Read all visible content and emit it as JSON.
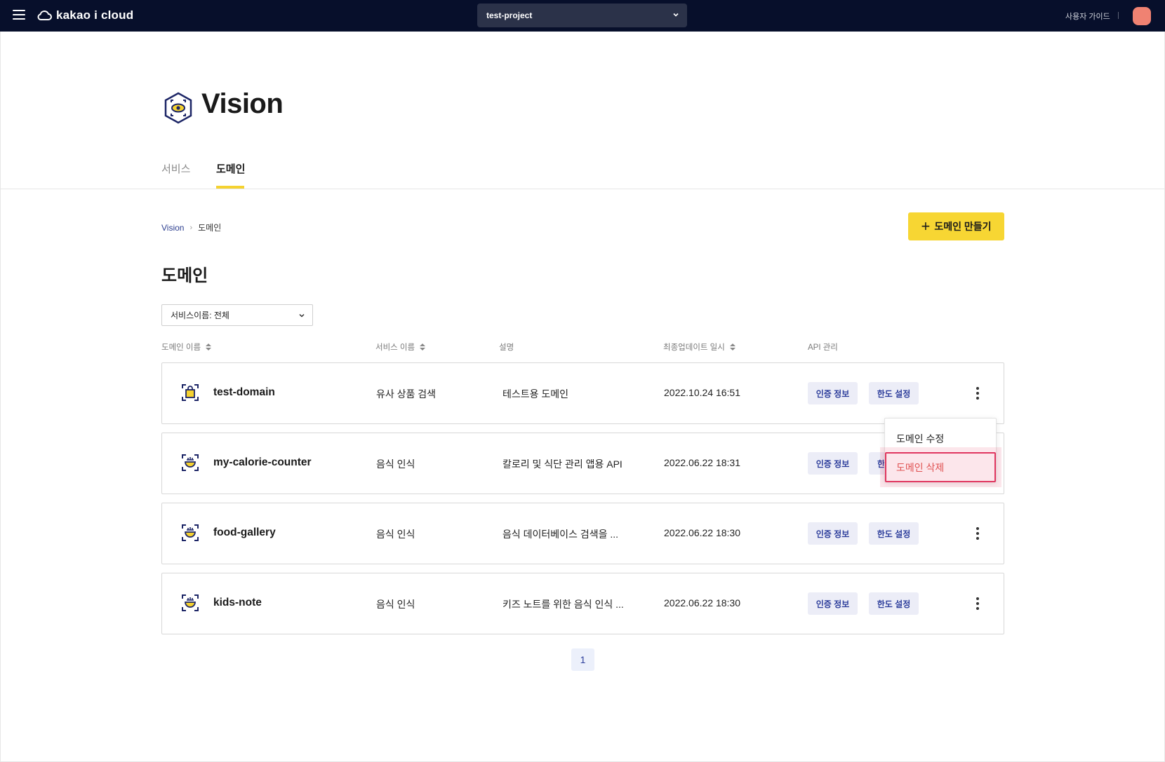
{
  "topbar": {
    "logo_text": "kakao i cloud",
    "project": "test-project",
    "user_guide": "사용자 가이드"
  },
  "hero": {
    "title": "Vision"
  },
  "tabs": [
    {
      "label": "서비스",
      "active": false
    },
    {
      "label": "도메인",
      "active": true
    }
  ],
  "breadcrumb": {
    "root": "Vision",
    "current": "도메인"
  },
  "create_button": "도메인 만들기",
  "section_title": "도메인",
  "filter": {
    "label": "서비스이름: 전체"
  },
  "table": {
    "headers": {
      "name": "도메인 이름",
      "service": "서비스 이름",
      "desc": "설명",
      "updated": "최종업데이트 일시",
      "api": "API 관리"
    },
    "auth_label": "인증 정보",
    "limit_label": "한도 설정",
    "rows": [
      {
        "name": "test-domain",
        "service": "유사 상품 검색",
        "desc": "테스트용 도메인",
        "updated": "2022.10.24 16:51",
        "icon": "shopping-bag-icon"
      },
      {
        "name": "my-calorie-counter",
        "service": "음식 인식",
        "desc": "칼로리 및 식단 관리 앱용 API",
        "updated": "2022.06.22 18:31",
        "icon": "food-bowl-icon"
      },
      {
        "name": "food-gallery",
        "service": "음식 인식",
        "desc": "음식 데이터베이스 검색을 ...",
        "updated": "2022.06.22 18:30",
        "icon": "food-bowl-icon"
      },
      {
        "name": "kids-note",
        "service": "음식 인식",
        "desc": "키즈 노트를 위한 음식 인식 ...",
        "updated": "2022.06.22 18:30",
        "icon": "food-bowl-icon"
      }
    ]
  },
  "row_menu": {
    "edit": "도메인 수정",
    "delete": "도메인 삭제",
    "partial_hidden_label": "한"
  },
  "pagination": {
    "current": "1"
  },
  "colors": {
    "topbar": "#070f2b",
    "accent_yellow": "#f7d633",
    "link_blue": "#2e3f9c",
    "danger": "#e05252"
  }
}
